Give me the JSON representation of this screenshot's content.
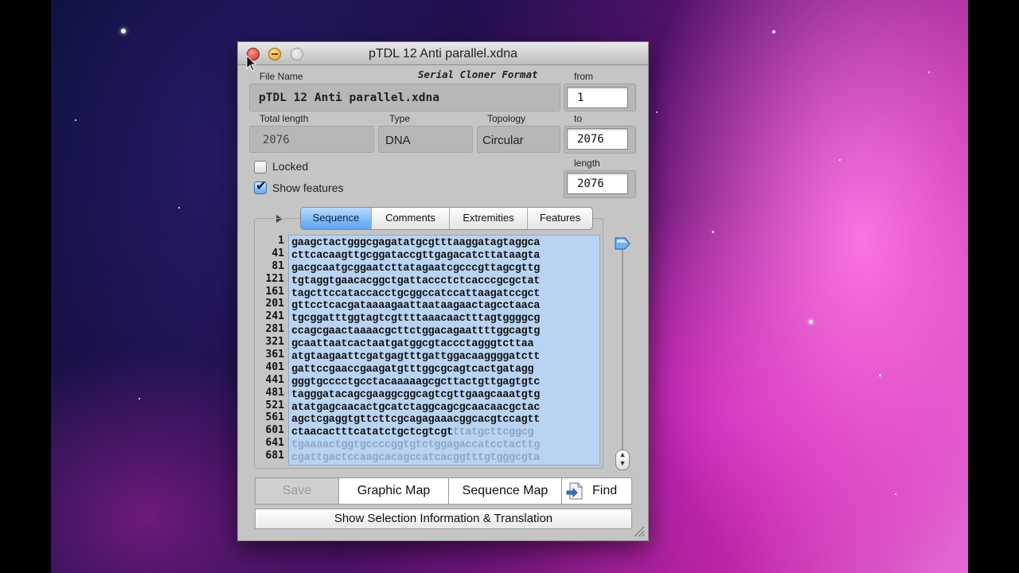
{
  "window": {
    "title": "pTDL 12 Anti parallel.xdna"
  },
  "header": {
    "file_name_label": "File Name",
    "format_label": "Serial Cloner Format",
    "file_name": "pTDL 12 Anti parallel.xdna"
  },
  "info": {
    "total_length_label": "Total length",
    "total_length": "2076",
    "type_label": "Type",
    "type": "DNA",
    "topology_label": "Topology",
    "topology": "Circular"
  },
  "range": {
    "from_label": "from",
    "from": "1",
    "to_label": "to",
    "to": "2076",
    "length_label": "length",
    "length": "2076"
  },
  "options": {
    "locked_label": "Locked",
    "locked": false,
    "show_features_label": "Show features",
    "show_features": true
  },
  "tabs": [
    {
      "label": "Sequence",
      "active": true
    },
    {
      "label": "Comments",
      "active": false
    },
    {
      "label": "Extremities",
      "active": false
    },
    {
      "label": "Features",
      "active": false
    }
  ],
  "sequence": {
    "line_numbers": [
      "1",
      "41",
      "81",
      "121",
      "161",
      "201",
      "241",
      "281",
      "321",
      "361",
      "401",
      "441",
      "481",
      "521",
      "561",
      "601",
      "641",
      "681"
    ],
    "lines": [
      "gaagctactgggcgagatatgcgtttaaggatagtaggca",
      "cttcacaagttgcggataccgttgagacatcttataagta",
      "gacgcaatgcggaatcttatagaatcgcccgttagcgttg",
      "tgtaggtgaacacggctgattaccctctcacccgcgctat",
      "tagcttccataccacctgcggccatccattaagatccgct",
      "gttcctcacgataaaagaattaataagaactagcctaaca",
      "tgcggatttggtagtcgttttaaacaactttagtggggcg",
      "ccagcgaactaaaacgcttctggacagaattttggcagtg",
      "gcaattaatcactaatgatggcgtaccctagggtcttaa",
      "atgtaagaattcgatgagtttgattggacaaggggatctt",
      "gattccgaaccgaagatgtttggcgcagtcactgatagg",
      "gggtgcccctgcctacaaaaagcgcttactgttgagtgtc",
      "tagggatacagcgaaggcggcagtcgttgaagcaaatgtg",
      "atatgagcaacactgcatctaggcagcgcaacaacgctac",
      "agctcgaggtgttcttcgcagagaaacggcacgtccagtt",
      "ctaacactttcatatctgctcgtcgt",
      "tgaaaactggtgccccggtgtctggagaccatcctacttg",
      "cgattgactccaagcacagccatcacggtttgtgggcgta"
    ],
    "line_16_dim_part": "ttatgcttcggcg"
  },
  "buttons": {
    "save": "Save",
    "graphic_map": "Graphic Map",
    "sequence_map": "Sequence Map",
    "find": "Find",
    "show_selection": "Show Selection Information & Translation"
  },
  "colors": {
    "selection": "#b9d4f2",
    "active_tab": "#5aa2f0",
    "window_bg": "#c5c5c5"
  }
}
